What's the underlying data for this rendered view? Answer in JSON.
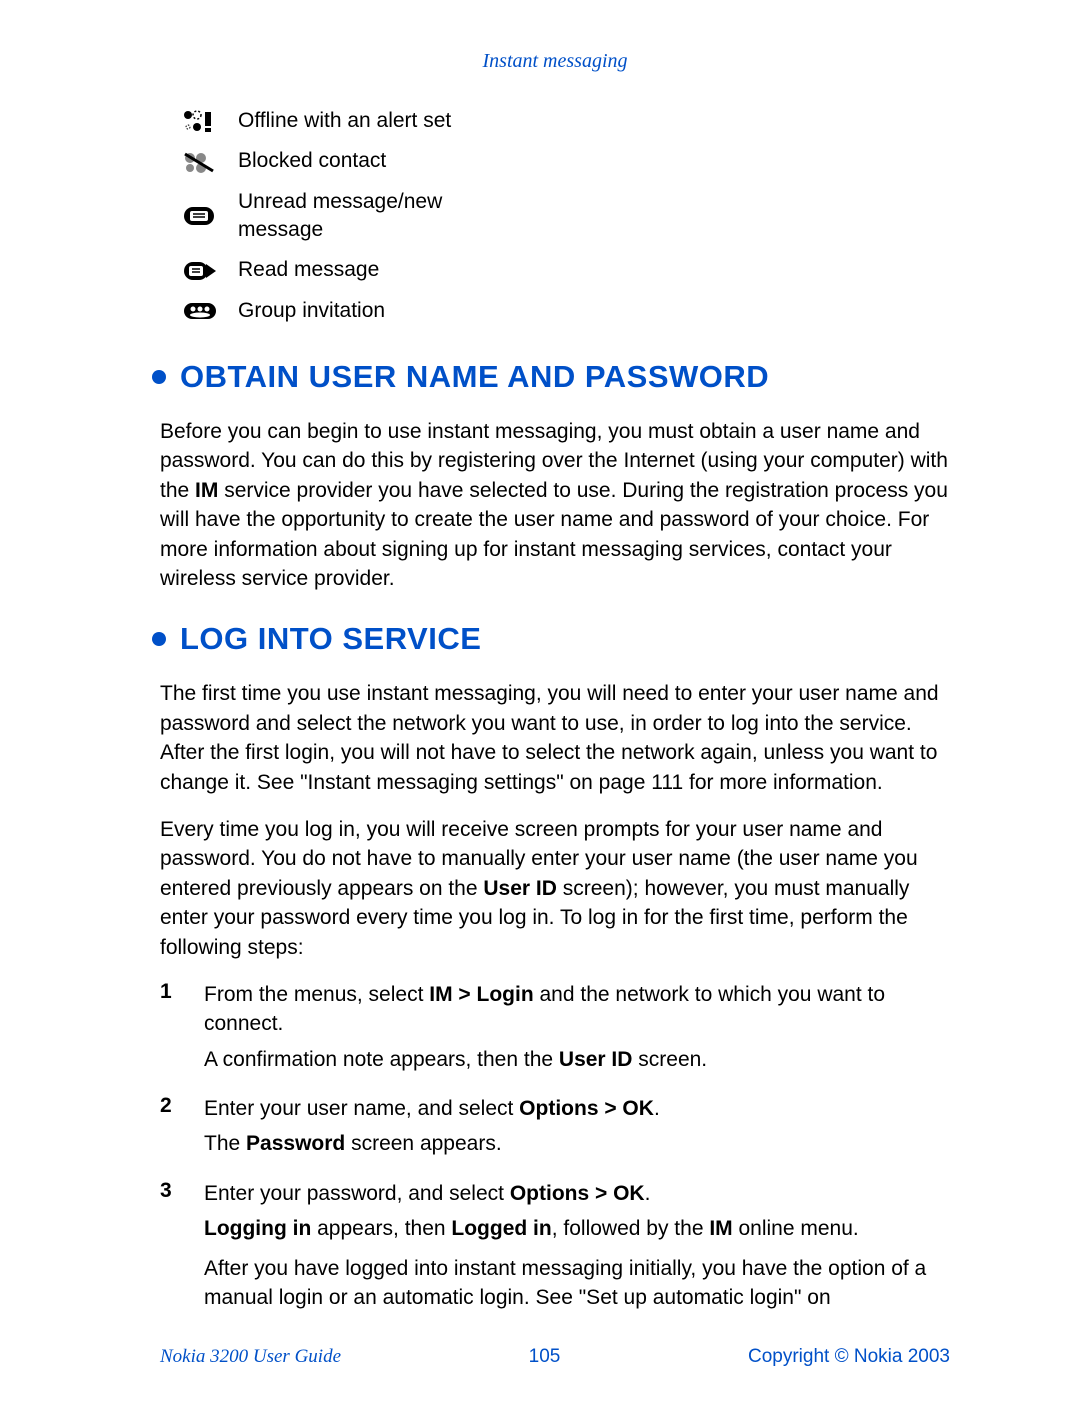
{
  "header": {
    "title": "Instant messaging"
  },
  "legend": {
    "items": [
      {
        "icon": "offline-alert-icon",
        "label": "Offline with an alert set"
      },
      {
        "icon": "blocked-contact-icon",
        "label": "Blocked contact"
      },
      {
        "icon": "unread-message-icon",
        "label": "Unread message/new message"
      },
      {
        "icon": "read-message-icon",
        "label": "Read message"
      },
      {
        "icon": "group-invitation-icon",
        "label": "Group invitation"
      }
    ]
  },
  "sections": {
    "obtain": {
      "heading": "OBTAIN USER NAME AND PASSWORD",
      "para_prefix": "Before you can begin to use instant messaging, you must obtain a user name and password. You can do this by registering over the Internet (using your computer) with the ",
      "para_bold1": "IM",
      "para_suffix": " service provider you have selected to use. During the registration process you will have the opportunity to create the user name and password of your choice. For more information about signing up for instant messaging services, contact your wireless service provider."
    },
    "log": {
      "heading": "LOG INTO SERVICE",
      "para1": "The first time you use instant messaging, you will need to enter your user name and password and select the network you want to use, in order to log into the service. After the first login, you will not have to select the network again, unless you want to change it. See \"Instant messaging settings\" on page 111 for more information.",
      "para2_prefix": "Every time you log in, you will receive screen prompts for your user name and password. You do not have to manually enter your user name (the user name you entered previously appears on the ",
      "para2_bold1": "User ID",
      "para2_suffix": " screen); however, you must manually enter your password every time you log in. To log in for the first time, perform the following steps:",
      "steps": [
        {
          "num": "1",
          "l1_pre": "From the menus, select ",
          "l1_bold": "IM > Login",
          "l1_post": " and the network to which you want to connect.",
          "l2_pre": "A confirmation note appears, then the ",
          "l2_bold": "User ID",
          "l2_post": " screen."
        },
        {
          "num": "2",
          "l1_pre": "Enter your user name, and select ",
          "l1_bold": "Options > OK",
          "l1_post": ".",
          "l2_pre": "The ",
          "l2_bold": "Password",
          "l2_post": " screen appears."
        },
        {
          "num": "3",
          "l1_pre": "Enter your password, and select ",
          "l1_bold": "Options > OK",
          "l1_post": ".",
          "l2_b1": "Logging in",
          "l2_mid1": " appears, then ",
          "l2_b2": "Logged in",
          "l2_mid2": ", followed by the ",
          "l2_b3": "IM",
          "l2_post": " online menu.",
          "l3": "After you have logged into instant messaging initially, you have the option of a manual login or an automatic login. See \"Set up automatic login\" on"
        }
      ]
    }
  },
  "footer": {
    "left": "Nokia 3200 User Guide",
    "center": "105",
    "right": "Copyright © Nokia 2003"
  }
}
